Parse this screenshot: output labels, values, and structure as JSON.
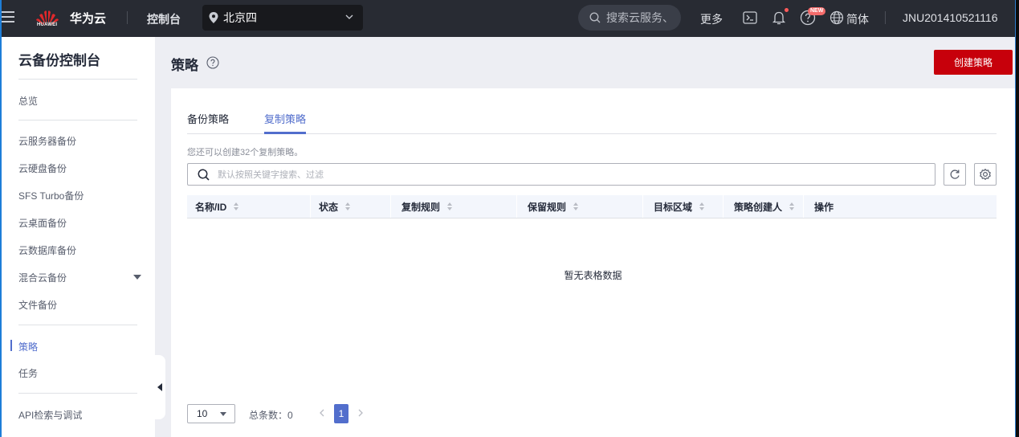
{
  "topbar": {
    "logo_text": "HUAWEI",
    "brand": "华为云",
    "console": "控制台",
    "region": "北京四",
    "search_placeholder": "搜索云服务、",
    "more": "更多",
    "new_badge": "NEW",
    "language": "简体",
    "account": "JNU201410521116"
  },
  "sidebar": {
    "title": "云备份控制台",
    "items": [
      {
        "label": "总览"
      },
      {
        "label": "云服务器备份"
      },
      {
        "label": "云硬盘备份"
      },
      {
        "label": "SFS Turbo备份"
      },
      {
        "label": "云桌面备份"
      },
      {
        "label": "云数据库备份"
      },
      {
        "label": "混合云备份",
        "expandable": true
      },
      {
        "label": "文件备份"
      },
      {
        "label": "策略",
        "active": true
      },
      {
        "label": "任务"
      },
      {
        "label": "API检索与调试"
      }
    ]
  },
  "page": {
    "title": "策略",
    "create_button": "创建策略"
  },
  "tabs": [
    {
      "label": "备份策略",
      "active": false
    },
    {
      "label": "复制策略",
      "active": true
    }
  ],
  "quota_tip": "您还可以创建32个复制策略。",
  "search": {
    "placeholder": "默认按照关键字搜索、过滤"
  },
  "table": {
    "columns": [
      {
        "label": "名称/ID",
        "sortable": true
      },
      {
        "label": "状态",
        "sortable": true
      },
      {
        "label": "复制规则",
        "sortable": true
      },
      {
        "label": "保留规则",
        "sortable": true
      },
      {
        "label": "目标区域",
        "sortable": true
      },
      {
        "label": "策略创建人",
        "sortable": true
      },
      {
        "label": "操作",
        "sortable": false
      }
    ],
    "rows": [],
    "empty_text": "暂无表格数据"
  },
  "pagination": {
    "page_size": "10",
    "total_label": "总条数：0",
    "current_page": "1"
  },
  "colors": {
    "topbar_bg": "#282b33",
    "accent": "#526ecc",
    "primary_button": "#c7000b"
  }
}
